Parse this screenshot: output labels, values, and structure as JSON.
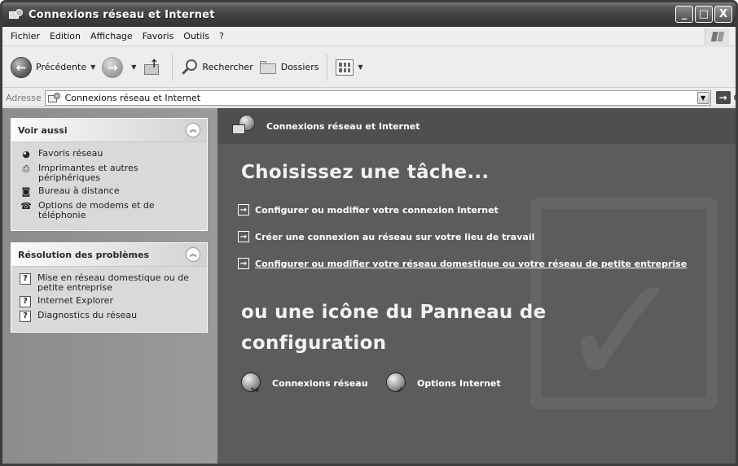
{
  "window": {
    "title": "Connexions réseau et Internet",
    "buttons": {
      "minimize": "_",
      "maximize": "□",
      "close": "X"
    }
  },
  "menubar": {
    "items": [
      "Fichier",
      "Edition",
      "Affichage",
      "Favoris",
      "Outils",
      "?"
    ]
  },
  "toolbar": {
    "back_label": "Précédente",
    "search_label": "Rechercher",
    "folders_label": "Dossiers"
  },
  "addressbar": {
    "label": "Adresse",
    "value": "Connexions réseau et Internet",
    "go_label": "OK"
  },
  "sidebar": {
    "see_also": {
      "title": "Voir aussi",
      "items": [
        {
          "label": "Favoris réseau",
          "icon": "network-places-icon"
        },
        {
          "label": "Imprimantes et autres périphériques",
          "icon": "printer-icon"
        },
        {
          "label": "Bureau à distance",
          "icon": "remote-desktop-icon"
        },
        {
          "label": "Options de modems et de téléphonie",
          "icon": "phone-modem-icon"
        }
      ]
    },
    "troubleshoot": {
      "title": "Résolution des problèmes",
      "items": [
        {
          "label": "Mise en réseau domestique ou de petite entreprise"
        },
        {
          "label": "Internet Explorer"
        },
        {
          "label": "Diagnostics du réseau"
        }
      ]
    }
  },
  "main": {
    "header_title": "Connexions réseau et Internet",
    "task_heading": "Choisissez une tâche...",
    "tasks": [
      "Configurer ou modifier votre connexion Internet",
      "Créer une connexion au réseau sur votre lieu de travail",
      "Configurer ou modifier votre réseau domestique ou votre réseau de petite entreprise"
    ],
    "icon_heading_line1": "ou une icône du Panneau de",
    "icon_heading_line2": "configuration",
    "control_panel_icons": [
      {
        "label": "Connexions réseau",
        "icon": "network-connections-icon"
      },
      {
        "label": "Options Internet",
        "icon": "internet-options-icon"
      }
    ]
  }
}
